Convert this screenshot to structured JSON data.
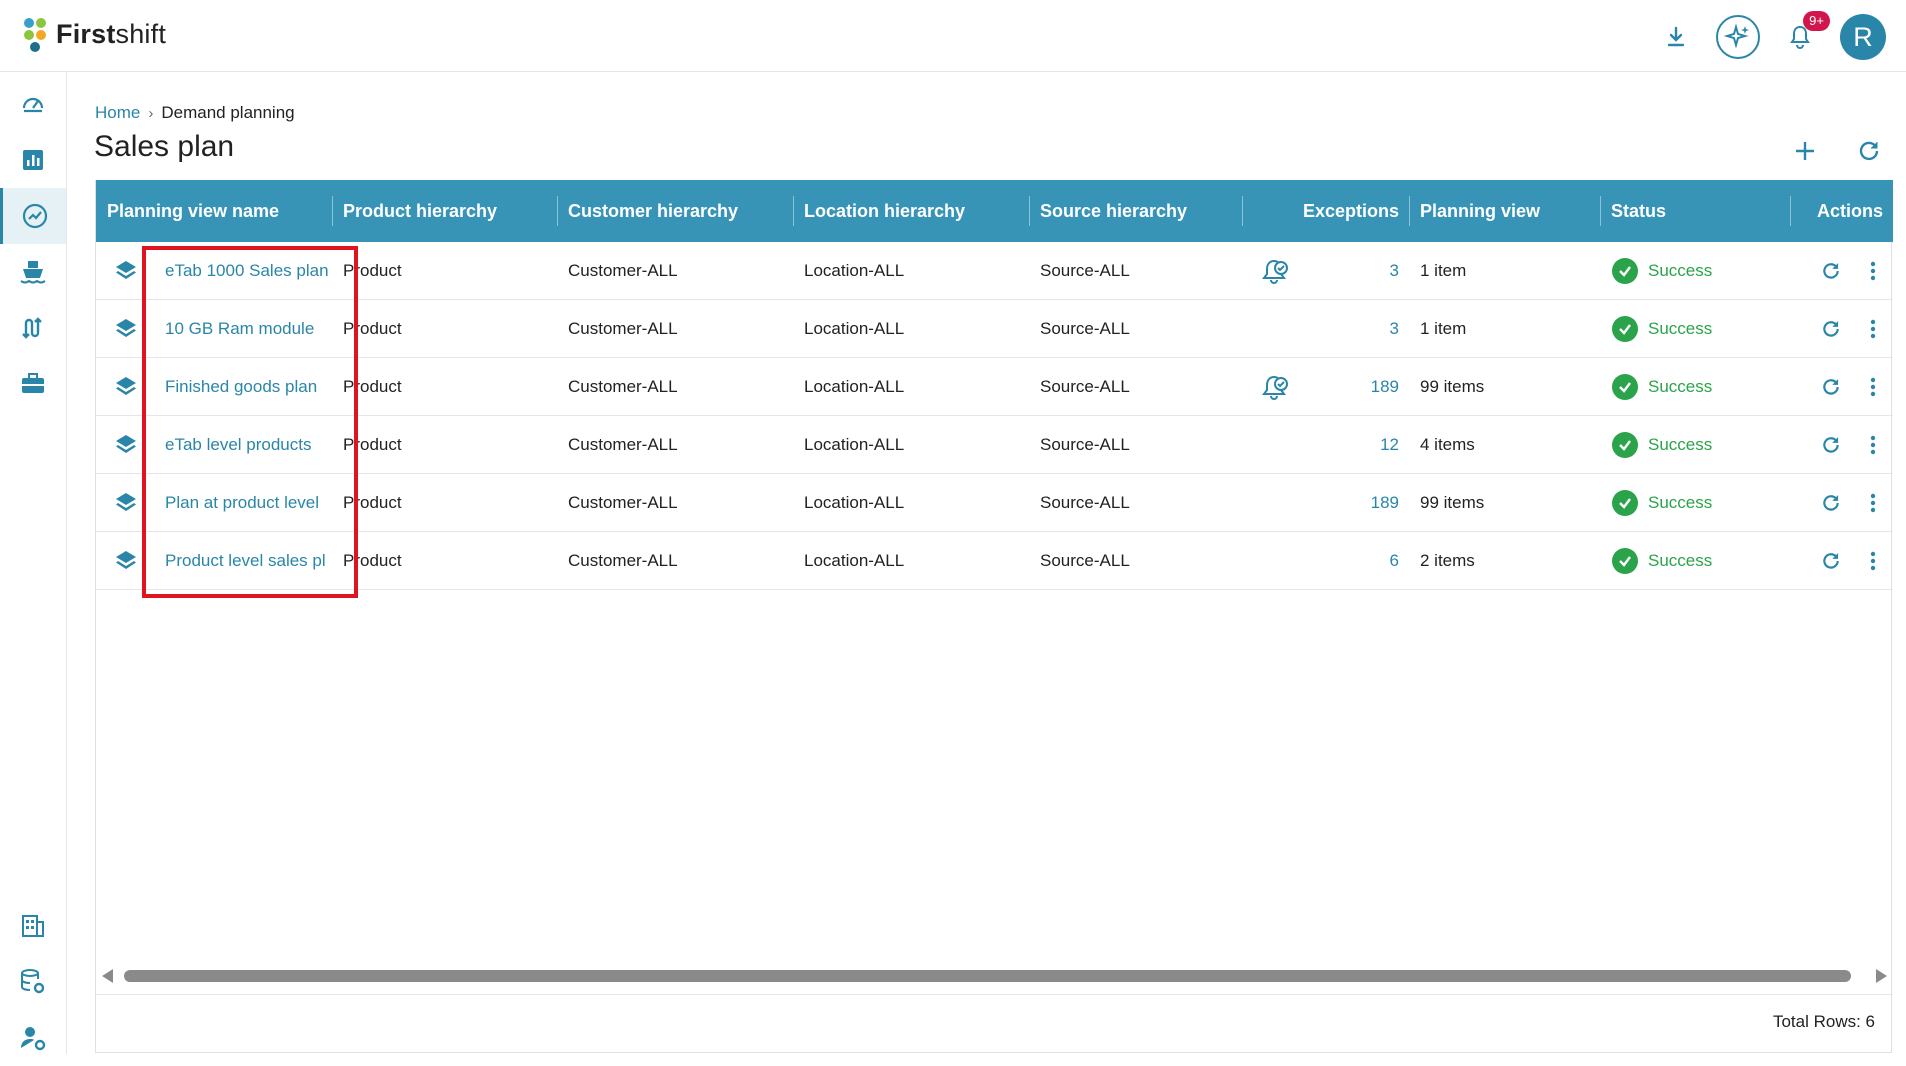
{
  "app": {
    "logo_bold": "First",
    "logo_light": "shift",
    "badge_count": "9+",
    "avatar_initial": "R",
    "brand_color": "#2a86a8",
    "logo_colors": [
      "#3aa0c9",
      "#8cc63f",
      "#f5a623",
      "#1f6e8c"
    ]
  },
  "breadcrumb": {
    "home": "Home",
    "separator": "›",
    "current": "Demand planning"
  },
  "page": {
    "title": "Sales plan"
  },
  "sidebar": {
    "items": [
      {
        "icon": "dashboard-gauge-icon",
        "active": false
      },
      {
        "icon": "bar-chart-icon",
        "active": false
      },
      {
        "icon": "trend-line-icon",
        "active": true
      },
      {
        "icon": "ship-icon",
        "active": false
      },
      {
        "icon": "route-icon",
        "active": false
      },
      {
        "icon": "briefcase-icon",
        "active": false
      },
      {
        "icon": "building-icon",
        "active": false
      },
      {
        "icon": "database-settings-icon",
        "active": false
      },
      {
        "icon": "user-settings-icon",
        "active": false
      }
    ]
  },
  "table": {
    "columns": {
      "name": "Planning view name",
      "product": "Product hierarchy",
      "customer": "Customer hierarchy",
      "location": "Location hierarchy",
      "source": "Source hierarchy",
      "exceptions": "Exceptions",
      "planning_view": "Planning view",
      "status": "Status",
      "actions": "Actions"
    },
    "rows": [
      {
        "name": "eTab 1000 Sales plan",
        "product": "Product",
        "customer": "Customer-ALL",
        "location": "Location-ALL",
        "source": "Source-ALL",
        "alert": true,
        "exceptions": "3",
        "planning_view": "1 item",
        "status": "Success"
      },
      {
        "name": "10 GB Ram module",
        "product": "Product",
        "customer": "Customer-ALL",
        "location": "Location-ALL",
        "source": "Source-ALL",
        "alert": false,
        "exceptions": "3",
        "planning_view": "1 item",
        "status": "Success"
      },
      {
        "name": "Finished goods plan",
        "product": "Product",
        "customer": "Customer-ALL",
        "location": "Location-ALL",
        "source": "Source-ALL",
        "alert": true,
        "exceptions": "189",
        "planning_view": "99 items",
        "status": "Success"
      },
      {
        "name": "eTab level products",
        "product": "Product",
        "customer": "Customer-ALL",
        "location": "Location-ALL",
        "source": "Source-ALL",
        "alert": false,
        "exceptions": "12",
        "planning_view": "4 items",
        "status": "Success"
      },
      {
        "name": "Plan at product level",
        "product": "Product",
        "customer": "Customer-ALL",
        "location": "Location-ALL",
        "source": "Source-ALL",
        "alert": false,
        "exceptions": "189",
        "planning_view": "99 items",
        "status": "Success"
      },
      {
        "name": "Product level sales pl",
        "product": "Product",
        "customer": "Customer-ALL",
        "location": "Location-ALL",
        "source": "Source-ALL",
        "alert": false,
        "exceptions": "6",
        "planning_view": "2 items",
        "status": "Success"
      }
    ],
    "total_rows_label": "Total Rows: 6"
  }
}
